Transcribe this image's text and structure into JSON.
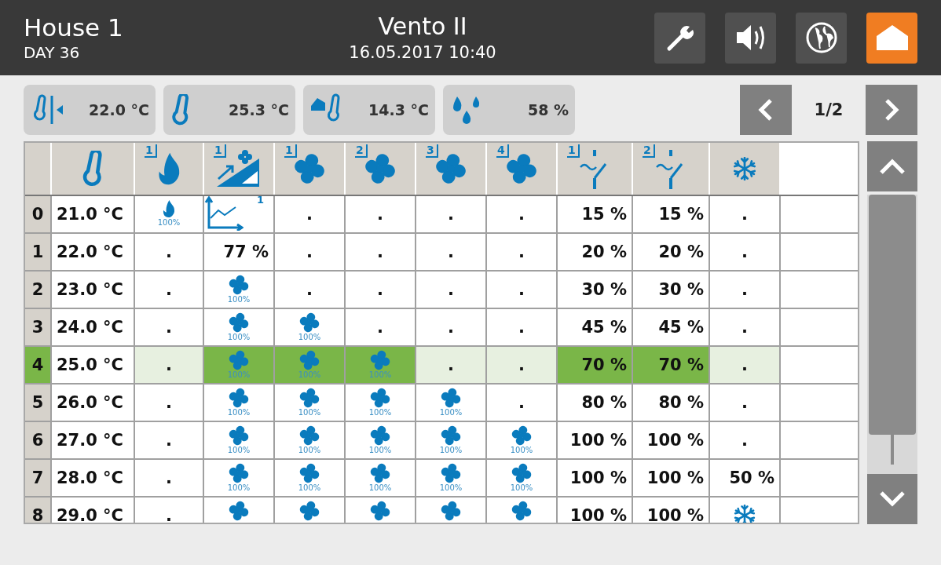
{
  "header": {
    "title": "House 1",
    "day": "DAY 36",
    "device": "Vento II",
    "datetime": "16.05.2017 10:40",
    "buttons": [
      {
        "kind": "wrench",
        "selected": false
      },
      {
        "kind": "speaker",
        "selected": false
      },
      {
        "kind": "globe",
        "selected": false
      },
      {
        "kind": "home",
        "selected": true
      }
    ]
  },
  "sensors": [
    {
      "kind": "supply",
      "value": "22.0 °C"
    },
    {
      "kind": "temp",
      "value": "25.3 °C"
    },
    {
      "kind": "outdoor",
      "value": "14.3 °C"
    },
    {
      "kind": "humidity",
      "value": "58 %"
    }
  ],
  "pager": {
    "page": "1/2"
  },
  "columns": [
    {
      "kind": "index"
    },
    {
      "kind": "temp"
    },
    {
      "kind": "flame",
      "badge": "1"
    },
    {
      "kind": "ramp",
      "badge": "1"
    },
    {
      "kind": "fan",
      "badge": "1"
    },
    {
      "kind": "fan",
      "badge": "2"
    },
    {
      "kind": "fan",
      "badge": "3"
    },
    {
      "kind": "fan",
      "badge": "4"
    },
    {
      "kind": "damper",
      "badge": "1"
    },
    {
      "kind": "damper",
      "badge": "2"
    },
    {
      "kind": "snow"
    }
  ],
  "rows": [
    {
      "index": "0",
      "temp": "21.0 °C",
      "selected": false,
      "cells": [
        {
          "kind": "flame",
          "label": "100%",
          "active": false
        },
        {
          "kind": "curve",
          "label": "1",
          "active": false
        },
        {
          "kind": "dot",
          "text": ".",
          "active": false
        },
        {
          "kind": "dot",
          "text": ".",
          "active": false
        },
        {
          "kind": "dot",
          "text": ".",
          "active": false
        },
        {
          "kind": "dot",
          "text": ".",
          "active": false
        },
        {
          "kind": "value",
          "text": "15 %",
          "active": false
        },
        {
          "kind": "value",
          "text": "15 %",
          "active": false
        },
        {
          "kind": "dot",
          "text": ".",
          "active": false
        }
      ]
    },
    {
      "index": "1",
      "temp": "22.0 °C",
      "selected": false,
      "cells": [
        {
          "kind": "dot",
          "text": ".",
          "active": false
        },
        {
          "kind": "value",
          "text": "77 %",
          "active": false
        },
        {
          "kind": "dot",
          "text": ".",
          "active": false
        },
        {
          "kind": "dot",
          "text": ".",
          "active": false
        },
        {
          "kind": "dot",
          "text": ".",
          "active": false
        },
        {
          "kind": "dot",
          "text": ".",
          "active": false
        },
        {
          "kind": "value",
          "text": "20 %",
          "active": false
        },
        {
          "kind": "value",
          "text": "20 %",
          "active": false
        },
        {
          "kind": "dot",
          "text": ".",
          "active": false
        }
      ]
    },
    {
      "index": "2",
      "temp": "23.0 °C",
      "selected": false,
      "cells": [
        {
          "kind": "dot",
          "text": ".",
          "active": false
        },
        {
          "kind": "fan",
          "label": "100%",
          "active": false
        },
        {
          "kind": "dot",
          "text": ".",
          "active": false
        },
        {
          "kind": "dot",
          "text": ".",
          "active": false
        },
        {
          "kind": "dot",
          "text": ".",
          "active": false
        },
        {
          "kind": "dot",
          "text": ".",
          "active": false
        },
        {
          "kind": "value",
          "text": "30 %",
          "active": false
        },
        {
          "kind": "value",
          "text": "30 %",
          "active": false
        },
        {
          "kind": "dot",
          "text": ".",
          "active": false
        }
      ]
    },
    {
      "index": "3",
      "temp": "24.0 °C",
      "selected": false,
      "cells": [
        {
          "kind": "dot",
          "text": ".",
          "active": false
        },
        {
          "kind": "fan",
          "label": "100%",
          "active": false
        },
        {
          "kind": "fan",
          "label": "100%",
          "active": false
        },
        {
          "kind": "dot",
          "text": ".",
          "active": false
        },
        {
          "kind": "dot",
          "text": ".",
          "active": false
        },
        {
          "kind": "dot",
          "text": ".",
          "active": false
        },
        {
          "kind": "value",
          "text": "45 %",
          "active": false
        },
        {
          "kind": "value",
          "text": "45 %",
          "active": false
        },
        {
          "kind": "dot",
          "text": ".",
          "active": false
        }
      ]
    },
    {
      "index": "4",
      "temp": "25.0 °C",
      "selected": true,
      "cells": [
        {
          "kind": "dot",
          "text": ".",
          "active": false
        },
        {
          "kind": "fan",
          "label": "100%",
          "active": true
        },
        {
          "kind": "fan",
          "label": "100%",
          "active": true
        },
        {
          "kind": "fan",
          "label": "100%",
          "active": true
        },
        {
          "kind": "dot",
          "text": ".",
          "active": false
        },
        {
          "kind": "dot",
          "text": ".",
          "active": false
        },
        {
          "kind": "value",
          "text": "70 %",
          "active": true
        },
        {
          "kind": "value",
          "text": "70 %",
          "active": true
        },
        {
          "kind": "dot",
          "text": ".",
          "active": false
        }
      ]
    },
    {
      "index": "5",
      "temp": "26.0 °C",
      "selected": false,
      "cells": [
        {
          "kind": "dot",
          "text": ".",
          "active": false
        },
        {
          "kind": "fan",
          "label": "100%",
          "active": false
        },
        {
          "kind": "fan",
          "label": "100%",
          "active": false
        },
        {
          "kind": "fan",
          "label": "100%",
          "active": false
        },
        {
          "kind": "fan",
          "label": "100%",
          "active": false
        },
        {
          "kind": "dot",
          "text": ".",
          "active": false
        },
        {
          "kind": "value",
          "text": "80 %",
          "active": false
        },
        {
          "kind": "value",
          "text": "80 %",
          "active": false
        },
        {
          "kind": "dot",
          "text": ".",
          "active": false
        }
      ]
    },
    {
      "index": "6",
      "temp": "27.0 °C",
      "selected": false,
      "cells": [
        {
          "kind": "dot",
          "text": ".",
          "active": false
        },
        {
          "kind": "fan",
          "label": "100%",
          "active": false
        },
        {
          "kind": "fan",
          "label": "100%",
          "active": false
        },
        {
          "kind": "fan",
          "label": "100%",
          "active": false
        },
        {
          "kind": "fan",
          "label": "100%",
          "active": false
        },
        {
          "kind": "fan",
          "label": "100%",
          "active": false
        },
        {
          "kind": "value",
          "text": "100 %",
          "active": false
        },
        {
          "kind": "value",
          "text": "100 %",
          "active": false
        },
        {
          "kind": "dot",
          "text": ".",
          "active": false
        }
      ]
    },
    {
      "index": "7",
      "temp": "28.0 °C",
      "selected": false,
      "cells": [
        {
          "kind": "dot",
          "text": ".",
          "active": false
        },
        {
          "kind": "fan",
          "label": "100%",
          "active": false
        },
        {
          "kind": "fan",
          "label": "100%",
          "active": false
        },
        {
          "kind": "fan",
          "label": "100%",
          "active": false
        },
        {
          "kind": "fan",
          "label": "100%",
          "active": false
        },
        {
          "kind": "fan",
          "label": "100%",
          "active": false
        },
        {
          "kind": "value",
          "text": "100 %",
          "active": false
        },
        {
          "kind": "value",
          "text": "100 %",
          "active": false
        },
        {
          "kind": "value",
          "text": "50 %",
          "active": false
        }
      ]
    },
    {
      "index": "8",
      "temp": "29.0 °C",
      "selected": false,
      "cells": [
        {
          "kind": "dot",
          "text": ".",
          "active": false
        },
        {
          "kind": "fan",
          "active": false
        },
        {
          "kind": "fan",
          "active": false
        },
        {
          "kind": "fan",
          "active": false
        },
        {
          "kind": "fan",
          "active": false
        },
        {
          "kind": "fan",
          "active": false
        },
        {
          "kind": "value",
          "text": "100 %",
          "active": false
        },
        {
          "kind": "value",
          "text": "100 %",
          "active": false
        },
        {
          "kind": "snow",
          "active": false
        }
      ]
    }
  ]
}
